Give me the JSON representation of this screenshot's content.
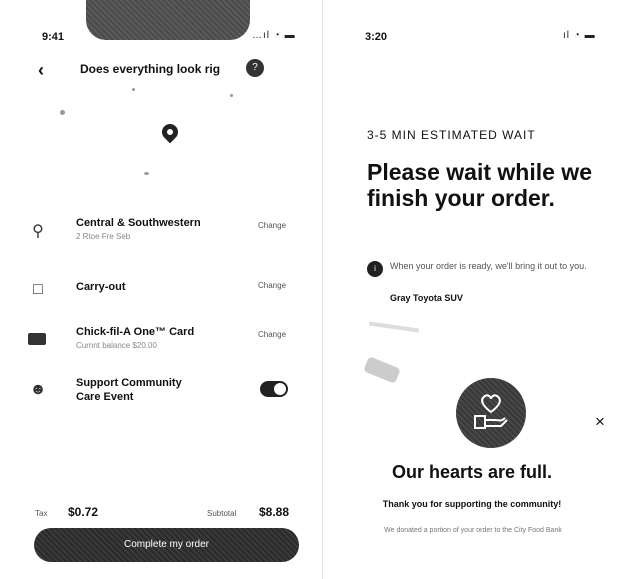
{
  "left": {
    "status": {
      "time": "9:41",
      "signal": "…ıl ◔ ▬"
    },
    "header": {
      "back": "‹",
      "title": "Does everything look rig",
      "help": "?"
    },
    "rows": [
      {
        "label": "Central & Southwestern",
        "sub": "2 Rtoe Fre Seb",
        "change": "Change",
        "icon": "location-pin-icon"
      },
      {
        "label": "Carry-out",
        "sub": "",
        "change": "Change",
        "icon": "bag-icon"
      },
      {
        "label": "Chick-fil-A One™ Card",
        "sub": "Curnnt balance $20.00",
        "change": "Change",
        "icon": "card-icon"
      },
      {
        "label": "Support Community",
        "label2": "Care Event",
        "icon": "community-icon",
        "toggle": "on"
      }
    ],
    "totals": {
      "tax_label": "Tax",
      "tax": "$0.72",
      "subtotal_label": "Subtotal",
      "subtotal": "$8.88"
    },
    "cta": "Complete my order"
  },
  "right": {
    "status": {
      "time": "3:20",
      "signal": "ıl ◔ ▬"
    },
    "wait": "3-5 MIN ESTIMATED WAIT",
    "headline": "Please wait while we finish your order.",
    "note": "When your order is ready, we'll bring it out to you.",
    "car": "Gray Toyota SUV",
    "close": "×",
    "full": "Our hearts are full.",
    "thanks": "Thank you for supporting the community!",
    "donate": "We donated a portion of your order to the City Food Bank"
  }
}
